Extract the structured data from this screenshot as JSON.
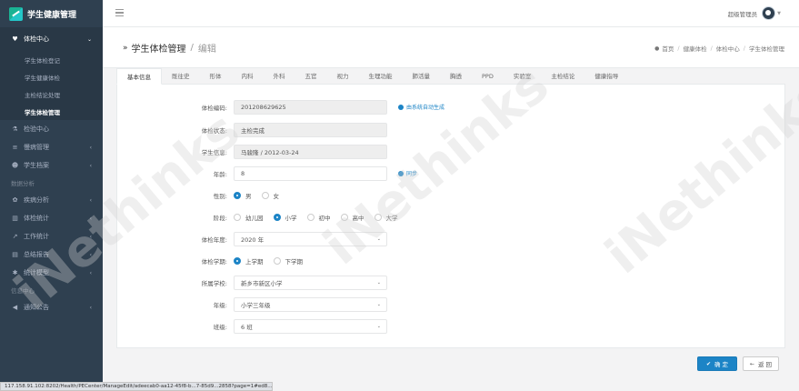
{
  "brand": {
    "title": "学生健康管理"
  },
  "sidebar": {
    "items": [
      {
        "label": "体检中心",
        "icon": "heartbeat-icon",
        "open": true
      },
      {
        "label": "检验中心",
        "icon": "flask-icon"
      },
      {
        "label": "慢病管理",
        "icon": "list-icon"
      },
      {
        "label": "学生档案",
        "icon": "user-icon"
      }
    ],
    "sub_items": [
      "学生体检登记",
      "学生健康体检",
      "主检结论处理",
      "学生体检管理"
    ],
    "sections": [
      "数据分析",
      "信息中心"
    ],
    "analysis_items": [
      {
        "label": "疾病分析",
        "icon": "disease-icon"
      },
      {
        "label": "体检统计",
        "icon": "bar-chart-icon"
      },
      {
        "label": "工作统计",
        "icon": "line-chart-icon"
      },
      {
        "label": "总结报告",
        "icon": "report-icon"
      },
      {
        "label": "统计模型",
        "icon": "model-icon"
      }
    ],
    "info_items": [
      {
        "label": "通知公告",
        "icon": "megaphone-icon"
      }
    ]
  },
  "topbar": {
    "user_name": "超级管理员"
  },
  "heading": {
    "title": "学生体检管理",
    "subtitle": "编辑",
    "breadcrumb": [
      "首页",
      "健康体检",
      "体检中心",
      "学生体检管理"
    ]
  },
  "tabs": [
    "基本信息",
    "既往史",
    "形体",
    "内科",
    "外科",
    "五官",
    "视力",
    "生理功能",
    "肺活量",
    "胸透",
    "PPD",
    "实验室",
    "主检结论",
    "健康指导"
  ],
  "form": {
    "exam_no": {
      "label": "体检编码:",
      "value": "201208629625",
      "hint": "由系统自动生成"
    },
    "status": {
      "label": "体检状态:",
      "value": "主检完成"
    },
    "student": {
      "label": "学生信息:",
      "value": "马骏隆 / 2012-03-24"
    },
    "age": {
      "label": "年龄:",
      "value": "8",
      "hint": "同步"
    },
    "gender": {
      "label": "性别:",
      "options": [
        "男",
        "女"
      ],
      "selected": "男"
    },
    "stage": {
      "label": "阶段:",
      "options": [
        "幼儿园",
        "小学",
        "初中",
        "高中",
        "大学"
      ],
      "selected": "小学"
    },
    "year": {
      "label": "体检年度:",
      "value": "2020 年"
    },
    "term": {
      "label": "体检学期:",
      "options": [
        "上学期",
        "下学期"
      ],
      "selected": "上学期"
    },
    "school": {
      "label": "所属学校:",
      "value": "新乡市新区小学"
    },
    "grade": {
      "label": "年级:",
      "value": "小学三年级"
    },
    "class": {
      "label": "班级:",
      "value": "6 班"
    }
  },
  "buttons": {
    "ok": "确 定",
    "back": "返 回"
  },
  "statusbar": {
    "url": "117.158.91.102:8202/Health/PECenter/ManageEdit/adeecab0-aa12-45f8-b...7-85d9...2858?page=1#ed8..."
  },
  "watermark": "iNethinks",
  "colors": {
    "primary": "#1c84c6",
    "sidebar": "#2f4050",
    "accent": "#1ab394"
  }
}
